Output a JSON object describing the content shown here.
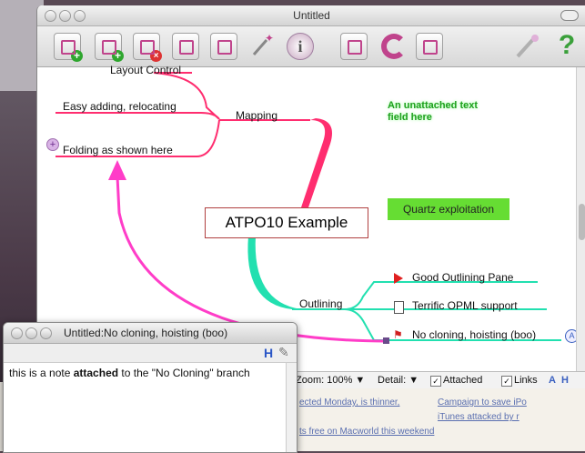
{
  "main_window": {
    "title": "Untitled"
  },
  "toolbar": {
    "icons": [
      "add-child-icon",
      "add-sibling-icon",
      "delete-node-icon",
      "layout-icon",
      "outline-icon",
      "magic-wand-icon",
      "info-icon",
      "chart-icon",
      "refresh-icon",
      "document-icon",
      "wrench-icon",
      "help-icon"
    ],
    "help_glyph": "?",
    "info_glyph": "i"
  },
  "map": {
    "central": "ATPO10 Example",
    "left_branch": {
      "label": "Mapping",
      "children": [
        "Layout Control",
        "Easy adding, relocating",
        "Folding as shown here"
      ]
    },
    "right_branch": {
      "label": "Outlining",
      "children": [
        "Good Outlining Pane",
        "Terrific OPML support",
        "No cloning, hoisting (boo)"
      ]
    },
    "quartz_node": "Quartz exploitation",
    "unattached_text": "An unattached text field here",
    "fold_glyph": "+",
    "link_badge": "A",
    "colors": {
      "left": "#ff2d6f",
      "right": "#22e0b0",
      "arrow": "#ff3dc8",
      "quartz_bg": "#66dd33"
    }
  },
  "statusbar": {
    "zoom": "Zoom: 100% ▼",
    "detail": "Detail: ▼",
    "attached": "Attached",
    "links": "Links",
    "check": "✓",
    "a_badge": "A",
    "h_badge": "H"
  },
  "web_links": [
    "ected Monday, is thinner,",
    "Campaign to save iPo",
    "iTunes attacked by r",
    "ts free on Macworld this weekend"
  ],
  "note_window": {
    "title": "Untitled:No cloning, hoisting (boo)",
    "body_prefix": "this is a note ",
    "body_bold": "attached",
    "body_suffix": " to the \"No Cloning\" branch",
    "h_glyph": "H"
  }
}
